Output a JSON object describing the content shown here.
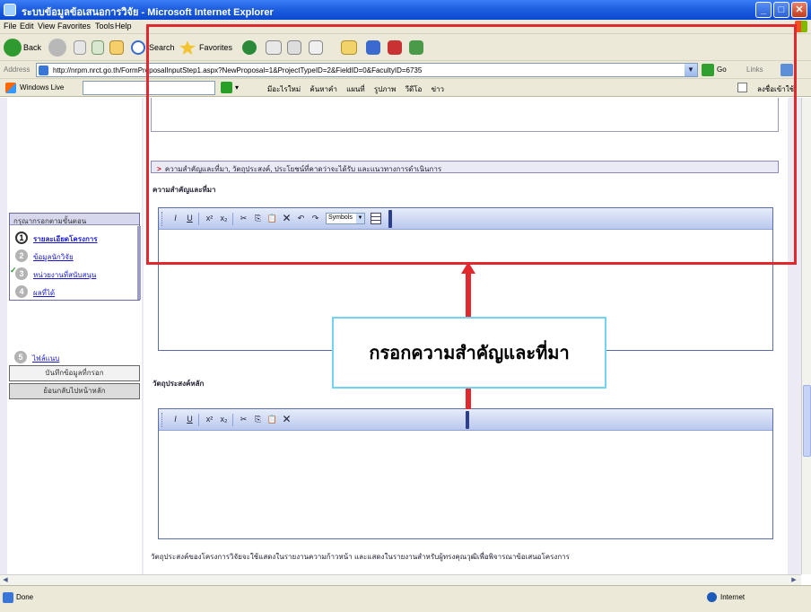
{
  "window": {
    "title": "ระบบข้อมูลข้อเสนอการวิจัย - Microsoft Internet Explorer",
    "buttons": {
      "minimize": "_",
      "maximize": "□",
      "close": "✕"
    }
  },
  "menubar": {
    "items": [
      "File",
      "Edit",
      "View",
      "Favorites",
      "Tools",
      "Help"
    ]
  },
  "toolbar": {
    "back_label": "Back",
    "search_label": "Search",
    "favorites_label": "Favorites"
  },
  "address": {
    "label": "Address",
    "url": "http://nrpm.nrct.go.th/FormProposalInputStep1.aspx?NewProposal=1&ProjectTypeID=2&FieldID=0&FacultyID=6735",
    "go_label": "Go",
    "links_label": "Links"
  },
  "livebar": {
    "label": "Windows Live",
    "links": [
      "มีอะไรใหม่",
      "ค้นหาคำ",
      "แผนที่",
      "รูปภาพ",
      "วีดีโอ",
      "ข่าว"
    ],
    "right_label": "ลงชื่อเข้าใช้"
  },
  "sidebar": {
    "steps_header": "กรุณากรอกตามขั้นตอน",
    "steps": [
      {
        "num": "1",
        "label": "รายละเอียดโครงการ"
      },
      {
        "num": "2",
        "label": "ข้อมูลนักวิจัย"
      },
      {
        "num": "3",
        "label": "หน่วยงานที่สนับสนุน"
      },
      {
        "num": "4",
        "label": "ผลที่ได้"
      },
      {
        "num": "5",
        "label": "ไฟล์แนบ"
      }
    ],
    "check_mark": "✓",
    "button_save": "บันทึกข้อมูลที่กรอก",
    "button_back": "ย้อนกลับไปหน้าหลัก"
  },
  "main": {
    "section_title": "ความสำคัญและที่มา, วัตถุประสงค์, ประโยชน์ที่คาดว่าจะได้รับ และแนวทางการดำเนินการ",
    "section_mark": ">",
    "field1_label": "ความสำคัญและที่มา",
    "field2_label": "วัตถุประสงค์หลัก",
    "symbols_label": "Symbols",
    "footer_note": "วัตถุประสงค์ของโครงการวิจัยจะใช้แสดงในรายงานความก้าวหน้า และแสดงในรายงานสำหรับผู้ทรงคุณวุฒิเพื่อพิจารณาข้อเสนอโครงการ"
  },
  "editor_buttons": [
    "I",
    "U",
    "x²",
    "x₂",
    "✂",
    "⎘",
    "📋",
    "✕",
    "↶",
    "↷"
  ],
  "annotation": {
    "callout_text": "กรอกความสำคัญและที่มา",
    "color": "#e0282e"
  },
  "statusbar": {
    "text": "Done",
    "zone": "Internet"
  },
  "colors": {
    "titlebar": "#1f5fe0",
    "chrome": "#ece9d8",
    "highlight": "#e0282e",
    "callout_border": "#72d3f2"
  }
}
